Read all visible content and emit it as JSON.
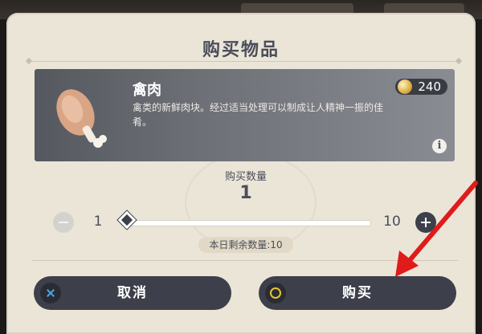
{
  "dialog": {
    "title": "购买物品"
  },
  "item": {
    "name": "禽肉",
    "description": "禽类的新鲜肉块。经过适当处理可以制成让人精神一振的佳肴。",
    "price": "240",
    "icon": "meat-drumstick-icon"
  },
  "quantity": {
    "label": "购买数量",
    "value": "1",
    "min": "1",
    "max": "10",
    "slider_fraction": 0
  },
  "remaining": {
    "text": "本日剩余数量:10"
  },
  "buttons": {
    "cancel": "取消",
    "buy": "购买"
  },
  "colors": {
    "dialog_bg": "#ebe5d8",
    "dark_button": "#3d404a",
    "card_bg": "#6e7078",
    "arrow": "#e01b1b"
  }
}
